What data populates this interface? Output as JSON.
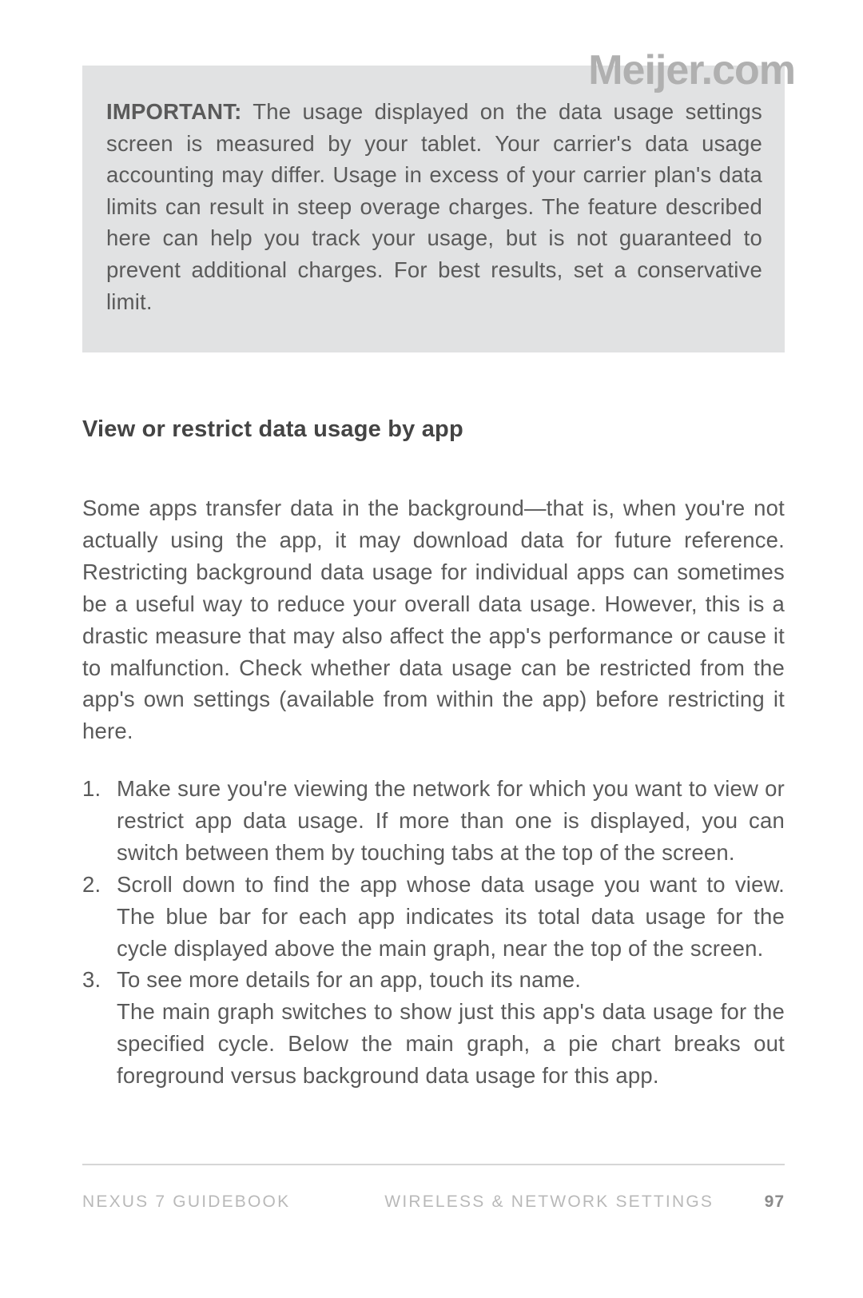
{
  "watermark": "Meijer.com",
  "callout": {
    "label": "IMPORTANT:",
    "text": "The usage displayed on the data usage settings screen is measured by your tablet. Your carrier's data usage accounting may differ. Usage in excess of your carrier plan's data limits can result in steep overage charges. The feature described here can help you track your usage, but is not guaranteed to prevent additional charges. For best results, set a conservative limit."
  },
  "heading": "View or restrict data usage by app",
  "paragraph": "Some apps transfer data in the background—that is, when you're not actually using the app, it may download data for future reference. Restricting background data usage for individual apps can sometimes be a useful way to reduce your overall data usage. However, this is a drastic measure that may also affect the app's performance or cause it to malfunction. Check whether data usage can be restricted from the app's own settings (available from within the app) before restricting it here.",
  "steps": {
    "s1": "Make sure you're viewing the network for which you want to view or restrict app data usage. If more than one is displayed, you can switch between them by touching tabs at the top of the screen.",
    "s2": "Scroll down to find the app whose data usage you want to view. The blue bar for each app indicates its total data usage for the cycle displayed above the main graph, near the top of the screen.",
    "s3a": "To see more details for an app, touch its name.",
    "s3b": "The main graph switches to show just this app's data usage for the specified cycle. Below the main graph, a pie chart breaks out foreground versus background data usage for this app."
  },
  "footer": {
    "book": "NEXUS 7 GUIDEBOOK",
    "section": "WIRELESS & NETWORK SETTINGS",
    "page": "97"
  }
}
